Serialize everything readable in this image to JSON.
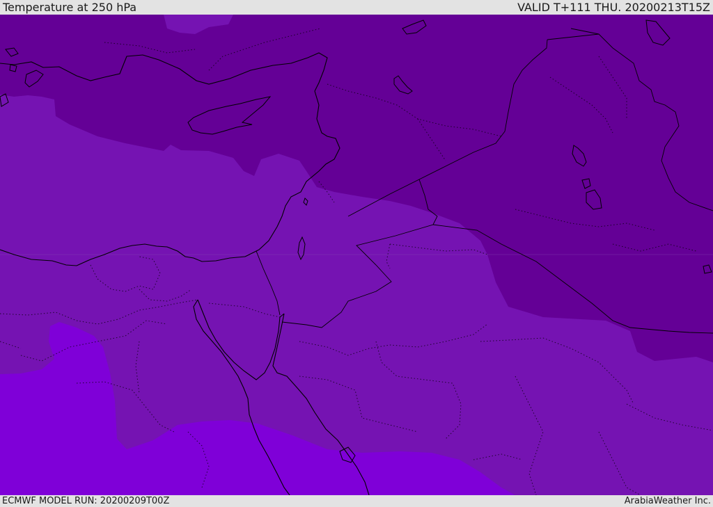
{
  "header": {
    "title": "Temperature at 250 hPa",
    "valid": "VALID T+111 THU. 20200213T15Z"
  },
  "footer": {
    "model_run": "ECMWF MODEL RUN: 20200209T00Z",
    "credit": "ArabiaWeather Inc."
  },
  "legend_colors": {
    "coldest": "#640096",
    "cold": "#7513b2",
    "warmer": "#7f00d8"
  }
}
